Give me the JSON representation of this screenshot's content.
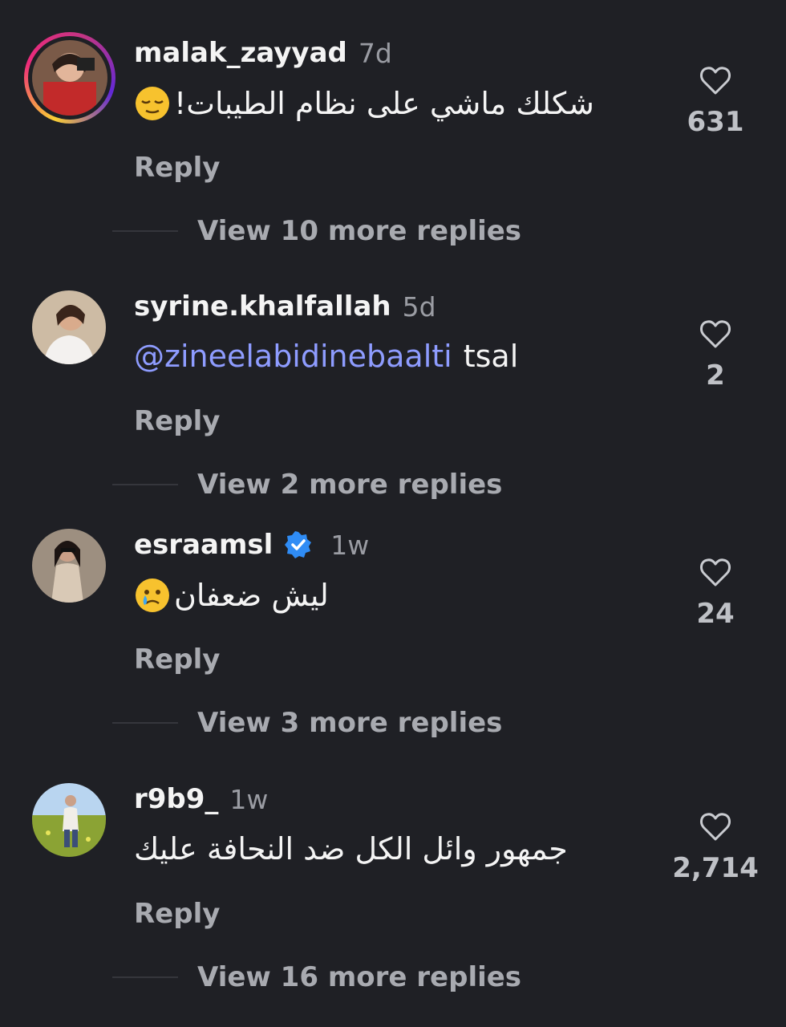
{
  "comments": [
    {
      "username": "malak_zayyad",
      "time": "7d",
      "verified": false,
      "text_prefix": "",
      "text": "شكلك ماشي على نظام الطيبات!",
      "emoji": "relieved-face",
      "likes": "631",
      "reply_label": "Reply",
      "more_label": "View 10 more replies"
    },
    {
      "username": "syrine.khalfallah",
      "time": "5d",
      "verified": false,
      "text_prefix": "@zineelabidinebaalti",
      "text": "tsal",
      "emoji": "",
      "likes": "2",
      "reply_label": "Reply",
      "more_label": "View 2 more replies"
    },
    {
      "username": "esraamsl",
      "time": "1w",
      "verified": true,
      "text_prefix": "",
      "text": "ليش ضعفان",
      "emoji": "crying-face",
      "likes": "24",
      "reply_label": "Reply",
      "more_label": "View 3 more replies"
    },
    {
      "username": "r9b9_",
      "time": "1w",
      "verified": false,
      "text_prefix": "",
      "text": "جمهور وائل الكل ضد النحافة عليك",
      "emoji": "",
      "likes": "2,714",
      "reply_label": "Reply",
      "more_label": "View 16 more replies"
    }
  ],
  "icons": {
    "like": "heart-outline-icon",
    "verified": "verified-badge-icon"
  },
  "colors": {
    "background": "#1f2025",
    "mention": "#8e9cff",
    "verified": "#2f8cf5",
    "muted": "#a8aab0"
  }
}
